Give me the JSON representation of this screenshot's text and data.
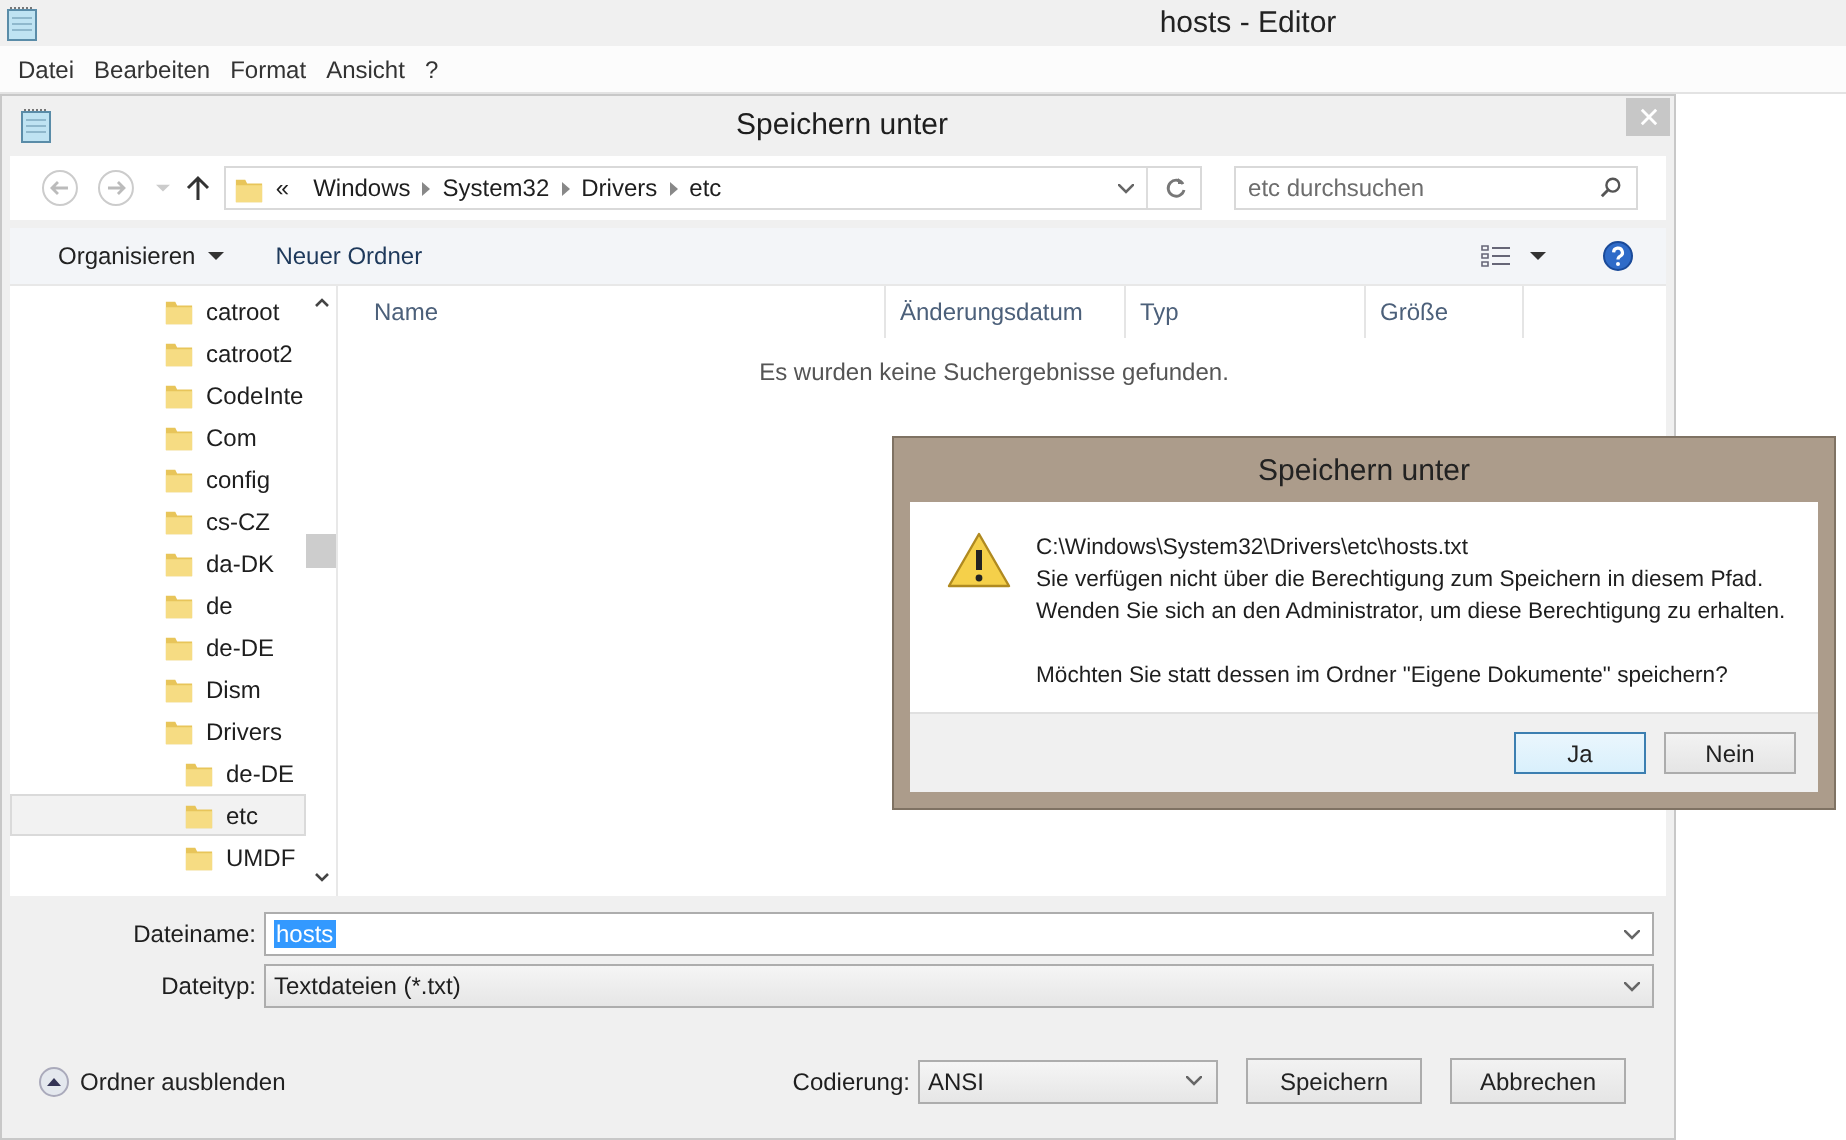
{
  "window": {
    "title": "hosts - Editor"
  },
  "menu": [
    "Datei",
    "Bearbeiten",
    "Format",
    "Ansicht",
    "?"
  ],
  "save_dialog": {
    "title": "Speichern unter",
    "breadcrumb": {
      "prefix": "«",
      "segments": [
        "Windows",
        "System32",
        "Drivers",
        "etc"
      ]
    },
    "search": {
      "placeholder": "etc durchsuchen"
    },
    "toolbar": {
      "organize": "Organisieren",
      "new_folder": "Neuer Ordner"
    },
    "folder_tree": [
      {
        "label": "catroot",
        "selected": false
      },
      {
        "label": "catroot2",
        "selected": false
      },
      {
        "label": "CodeInte",
        "selected": false
      },
      {
        "label": "Com",
        "selected": false
      },
      {
        "label": "config",
        "selected": false
      },
      {
        "label": "cs-CZ",
        "selected": false
      },
      {
        "label": "da-DK",
        "selected": false
      },
      {
        "label": "de",
        "selected": false
      },
      {
        "label": "de-DE",
        "selected": false
      },
      {
        "label": "Dism",
        "selected": false
      },
      {
        "label": "Drivers",
        "selected": false,
        "children": [
          {
            "label": "de-DE",
            "selected": false
          },
          {
            "label": "etc",
            "selected": true
          },
          {
            "label": "UMDF",
            "selected": false
          }
        ]
      }
    ],
    "columns": [
      "Name",
      "Änderungsdatum",
      "Typ",
      "Größe"
    ],
    "empty_message": "Es wurden keine Suchergebnisse gefunden.",
    "file_name": {
      "label": "Dateiname:",
      "value": "hosts"
    },
    "file_type": {
      "label": "Dateityp:",
      "value": "Textdateien (*.txt)"
    },
    "hide_folders": "Ordner ausblenden",
    "encoding": {
      "label": "Codierung:",
      "value": "ANSI"
    },
    "buttons": [
      "Speichern",
      "Abbrechen"
    ]
  },
  "message_box": {
    "title": "Speichern unter",
    "lines": [
      "C:\\Windows\\System32\\Drivers\\etc\\hosts.txt",
      "Sie verfügen nicht über die Berechtigung zum Speichern in diesem Pfad.",
      "Wenden Sie sich an den Administrator, um diese Berechtigung zu erhalten."
    ],
    "question": "Möchten Sie statt dessen im Ordner \"Eigene Dokumente\" speichern?",
    "buttons": [
      {
        "label": "Ja",
        "selected": true
      },
      {
        "label": "Nein",
        "selected": false
      }
    ]
  }
}
